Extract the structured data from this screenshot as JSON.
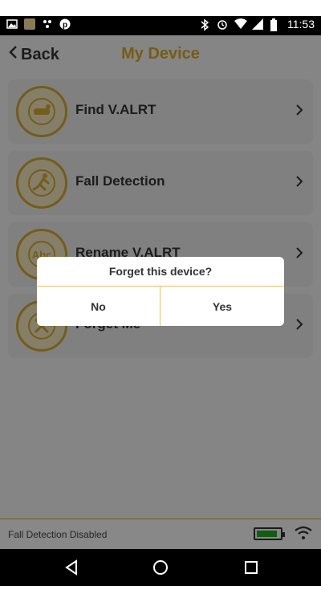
{
  "status_bar": {
    "time": "11:53"
  },
  "header": {
    "back_label": "Back",
    "title": "My Device"
  },
  "menu": {
    "items": [
      {
        "label": "Find V.ALRT"
      },
      {
        "label": "Fall Detection"
      },
      {
        "label": "Rename V.ALRT"
      },
      {
        "label": "Forget Me"
      }
    ]
  },
  "dialog": {
    "question": "Forget this device?",
    "no_label": "No",
    "yes_label": "Yes"
  },
  "footer": {
    "status_text": "Fall Detection Disabled",
    "battery_level_percent": 90
  },
  "colors": {
    "accent": "#d6a92b",
    "battery": "#24a824"
  }
}
